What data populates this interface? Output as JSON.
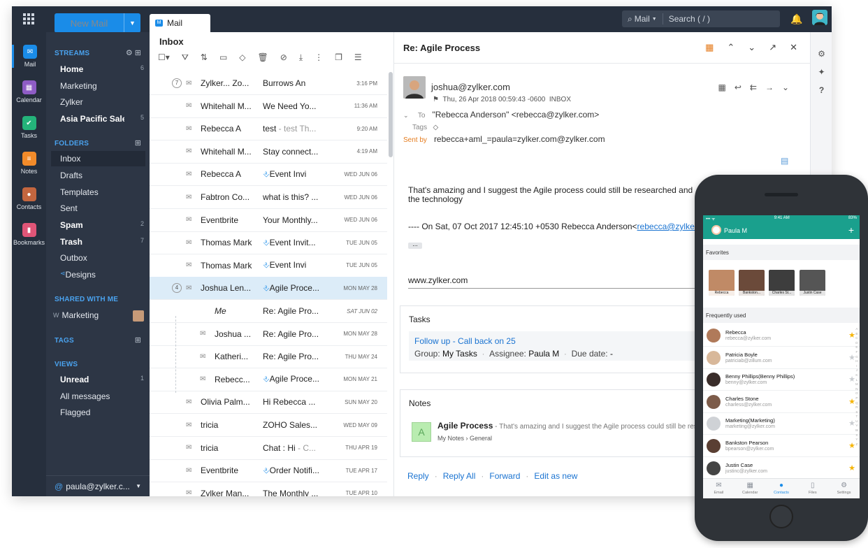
{
  "topbar": {
    "new_mail": "New Mail",
    "tab_label": "Mail",
    "tab_badge": "M",
    "search_scope": "Mail",
    "search_placeholder": "Search ( / )"
  },
  "rail": [
    {
      "label": "Mail",
      "color": "#1a8ce8"
    },
    {
      "label": "Calendar",
      "color": "#8e5cc5"
    },
    {
      "label": "Tasks",
      "color": "#24b37a"
    },
    {
      "label": "Notes",
      "color": "#f28b2a"
    },
    {
      "label": "Contacts",
      "color": "#c3663f"
    },
    {
      "label": "Bookmarks",
      "color": "#e05577"
    }
  ],
  "folders": {
    "streams_header": "STREAMS",
    "streams": [
      {
        "label": "Home",
        "count": "6",
        "bold": true
      },
      {
        "label": "Marketing",
        "count": ""
      },
      {
        "label": "Zylker",
        "count": ""
      },
      {
        "label": "Asia Pacific Sales",
        "count": "5",
        "bold": true
      }
    ],
    "folders_header": "FOLDERS",
    "folders": [
      {
        "label": "Inbox"
      },
      {
        "label": "Drafts"
      },
      {
        "label": "Templates"
      },
      {
        "label": "Sent"
      },
      {
        "label": "Spam",
        "count": "2"
      },
      {
        "label": "Trash",
        "count": "7"
      },
      {
        "label": "Outbox"
      },
      {
        "label": "Designs"
      }
    ],
    "shared_header": "SHARED WITH ME",
    "shared_prefix": "W",
    "shared_item": "Marketing",
    "tags_header": "TAGS",
    "views_header": "VIEWS",
    "views": [
      {
        "label": "Unread",
        "count": "1"
      },
      {
        "label": "All messages"
      },
      {
        "label": "Flagged"
      }
    ],
    "account": "paula@zylker.c..."
  },
  "list": {
    "header": "Inbox",
    "rows": [
      {
        "count": "7",
        "from": "Zylker... Zo...",
        "subject": "Burrows An",
        "preview": "",
        "date": "3:16 PM"
      },
      {
        "from": "Whitehall M...",
        "subject": "We Need Yo...",
        "preview": "",
        "date": "11:36 AM"
      },
      {
        "from": "Rebecca A",
        "subject": "test",
        "preview": " - test Th...",
        "date": "9:20 AM"
      },
      {
        "from": "Whitehall M...",
        "subject": "Stay connect...",
        "preview": "",
        "date": "4:19 AM"
      },
      {
        "from": "Rebecca A",
        "subject": "Event Invi",
        "preview": "",
        "date": "WED JUN 06",
        "clip": true
      },
      {
        "from": "Fabtron Co...",
        "subject": "what is this? ...",
        "preview": "",
        "date": "WED JUN 06"
      },
      {
        "from": "Eventbrite",
        "subject": "Your Monthly...",
        "preview": "",
        "date": "WED JUN 06"
      },
      {
        "from": "Thomas Mark",
        "subject": "Event Invit...",
        "preview": "",
        "date": "TUE JUN 05",
        "clip": true
      },
      {
        "from": "Thomas Mark",
        "subject": "Event Invi",
        "preview": "",
        "date": "TUE JUN 05",
        "clip": true
      },
      {
        "count": "4",
        "from": "Joshua Len...",
        "subject": "Agile Proce...",
        "preview": "",
        "date": "MON MAY 28",
        "clip": true,
        "selected": true
      },
      {
        "from": "Me",
        "subject": "Re: Agile Pro...",
        "preview": "",
        "date": "SAT JUN 02",
        "child": true,
        "me": true
      },
      {
        "from": "Joshua ...",
        "subject": "Re: Agile Pro...",
        "preview": "",
        "date": "MON MAY 28",
        "child": true
      },
      {
        "from": "Katheri...",
        "subject": "Re: Agile Pro...",
        "preview": "",
        "date": "THU MAY 24",
        "child": true
      },
      {
        "from": "Rebecc...",
        "subject": "Agile Proce...",
        "preview": "",
        "date": "MON MAY 21",
        "child": true,
        "clip": true
      },
      {
        "from": "Olivia Palm...",
        "subject": "Hi Rebecca ...",
        "preview": "",
        "date": "SUN MAY 20"
      },
      {
        "from": "tricia",
        "subject": "ZOHO Sales...",
        "preview": "",
        "date": "WED MAY 09"
      },
      {
        "from": "tricia",
        "subject": "Chat : Hi",
        "preview": " - C...",
        "date": "THU APR 19"
      },
      {
        "from": "Eventbrite",
        "subject": "Order Notifi...",
        "preview": "",
        "date": "TUE APR 17",
        "clip": true
      },
      {
        "from": "Zylker Man...",
        "subject": "The Monthly ...",
        "preview": "",
        "date": "TUE APR 10"
      }
    ]
  },
  "reader": {
    "title": "Re: Agile Process",
    "sender": "joshua@zylker.com",
    "date": "Thu, 26 Apr 2018 00:59:43 -0600",
    "folder": "INBOX",
    "to_label": "To",
    "to": "\"Rebecca Anderson\" <rebecca@zylker.com>",
    "tags_label": "Tags",
    "sentby_label": "Sent by",
    "sentby": "rebecca+aml_=paula=zylker.com@zylker.com",
    "body1": "That's amazing  and I suggest the Agile process could still be researched and",
    "body2": "the technology",
    "quote_prefix": "---- On Sat, 07 Oct 2017 12:45:10 +0530 Rebecca Anderson<",
    "quote_link": "rebecca@zylker",
    "signature": "www.zylker.com",
    "tasks_title": "Tasks",
    "task_name": "Follow up - Call back on 25",
    "task_group_label": "Group:",
    "task_group": "My Tasks",
    "task_assignee_label": "Assignee:",
    "task_assignee": "Paula M",
    "task_due_label": "Due date:",
    "task_due": "-",
    "notes_title": "Notes",
    "note_icon": "A",
    "note_name": "Agile Process",
    "note_preview": " - That's amazing and I suggest the Agile process could still be rese",
    "note_path1": "My Notes",
    "note_path2": "General",
    "actions": [
      "Reply",
      "Reply All",
      "Forward",
      "Edit as new"
    ]
  },
  "phone": {
    "time": "9:41 AM",
    "battery": "83%",
    "user": "Paula M",
    "favorites_title": "Favorites",
    "favorites": [
      "Rebecca",
      "Bankston...",
      "Charles St...",
      "Justin Case"
    ],
    "frequent_title": "Frequently used",
    "contacts": [
      {
        "name": "Rebecca",
        "email": "rebecca@zylker.com",
        "star": true
      },
      {
        "name": "Patricia Boyle",
        "email": "patriciab@zillum.com",
        "star": false
      },
      {
        "name": "Benny Phillips(Benny Phillips)",
        "email": "benny@zylker.com",
        "star": false
      },
      {
        "name": "Charles Stone",
        "email": "charless@zylker.com",
        "star": true
      },
      {
        "name": "Marketing(Marketing)",
        "email": "marketing@zylker.com",
        "star": false
      },
      {
        "name": "Bankston Pearson",
        "email": "bpearson@zylker.com",
        "star": true
      },
      {
        "name": "Justin Case",
        "email": "justinc@zylker.com",
        "star": true
      }
    ],
    "nav": [
      "Email",
      "Calendar",
      "Contacts",
      "Files",
      "Settings"
    ]
  },
  "colors": {
    "accent": "#1a8ce8",
    "teal": "#1aa08d",
    "sidebar": "#2d3645"
  }
}
